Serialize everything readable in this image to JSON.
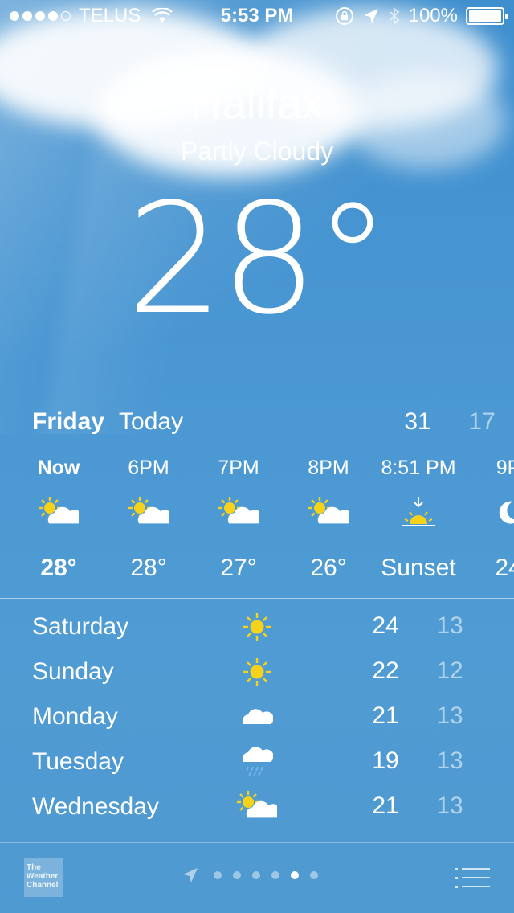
{
  "status_bar": {
    "carrier": "TELUS",
    "time": "5:53 PM",
    "battery": "100%",
    "signal_bars": 4
  },
  "location": {
    "city": "Halifax",
    "condition": "Partly Cloudy",
    "temperature": "28°"
  },
  "today": {
    "day": "Friday",
    "label": "Today",
    "high": "31",
    "low": "17"
  },
  "hourly": [
    {
      "time": "Now",
      "icon": "partly-cloudy-icon",
      "value": "28°"
    },
    {
      "time": "6PM",
      "icon": "partly-cloudy-icon",
      "value": "28°"
    },
    {
      "time": "7PM",
      "icon": "partly-cloudy-icon",
      "value": "27°"
    },
    {
      "time": "8PM",
      "icon": "partly-cloudy-icon",
      "value": "26°"
    },
    {
      "time": "8:51 PM",
      "icon": "sunset-icon",
      "value": "Sunset"
    },
    {
      "time": "9P",
      "icon": "moon-icon",
      "value": "24"
    }
  ],
  "daily": [
    {
      "day": "Saturday",
      "icon": "sunny-icon",
      "high": "24",
      "low": "13"
    },
    {
      "day": "Sunday",
      "icon": "sunny-icon",
      "high": "22",
      "low": "12"
    },
    {
      "day": "Monday",
      "icon": "cloudy-icon",
      "high": "21",
      "low": "13"
    },
    {
      "day": "Tuesday",
      "icon": "rain-icon",
      "high": "19",
      "low": "13"
    },
    {
      "day": "Wednesday",
      "icon": "partly-cloudy-icon",
      "high": "21",
      "low": "13"
    }
  ],
  "footer": {
    "logo_text": "The Weather Channel",
    "page_count": 7,
    "active_page": 5
  },
  "colors": {
    "sky": "#4a97d3",
    "sun": "#f7d21a",
    "muted_text": "rgba(255,255,255,0.55)"
  }
}
